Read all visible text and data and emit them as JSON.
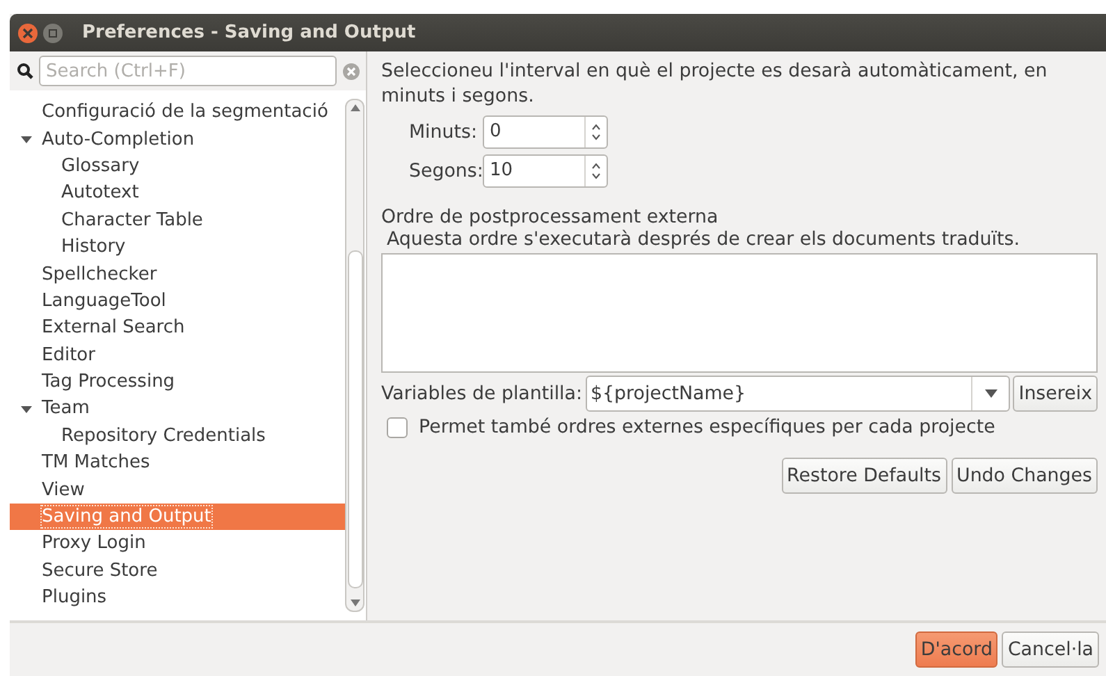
{
  "window": {
    "title": "Preferences - Saving and Output"
  },
  "search": {
    "placeholder": "Search (Ctrl+F)"
  },
  "tree": [
    {
      "label": "Configuració de la segmentació",
      "selected": false
    },
    {
      "label": "Auto-Completion",
      "selected": false,
      "expanded": true,
      "children": [
        {
          "label": "Glossary",
          "selected": false
        },
        {
          "label": "Autotext",
          "selected": false
        },
        {
          "label": "Character Table",
          "selected": false
        },
        {
          "label": "History",
          "selected": false
        }
      ]
    },
    {
      "label": "Spellchecker",
      "selected": false
    },
    {
      "label": "LanguageTool",
      "selected": false
    },
    {
      "label": "External Search",
      "selected": false
    },
    {
      "label": "Editor",
      "selected": false
    },
    {
      "label": "Tag Processing",
      "selected": false
    },
    {
      "label": "Team",
      "selected": false,
      "expanded": true,
      "children": [
        {
          "label": "Repository Credentials",
          "selected": false
        }
      ]
    },
    {
      "label": "TM Matches",
      "selected": false
    },
    {
      "label": "View",
      "selected": false
    },
    {
      "label": "Saving and Output",
      "selected": true
    },
    {
      "label": "Proxy Login",
      "selected": false
    },
    {
      "label": "Secure Store",
      "selected": false
    },
    {
      "label": "Plugins",
      "selected": false
    }
  ],
  "panel": {
    "intro": "Seleccioneu l'interval en què el projecte es desarà automàticament, en minuts i segons.",
    "spinners": [
      {
        "label": "Minuts:",
        "value": "0"
      },
      {
        "label": "Segons:",
        "value": "10"
      }
    ],
    "command_heading": "Ordre de postprocessament externa",
    "command_hint": "Aquesta ordre s'executarà després de crear els documents traduïts.",
    "variables": {
      "label": "Variables de plantilla:",
      "value": "${projectName}",
      "insert_button": "Insereix"
    },
    "per_project": {
      "label": "Permet també ordres externes específiques per cada projecte",
      "checked": false
    },
    "buttons": [
      "Restore Defaults",
      "Undo Changes"
    ]
  },
  "footer_buttons": [
    {
      "label": "D'acord",
      "default": true
    },
    {
      "label": "Cancel·la",
      "default": false
    }
  ]
}
